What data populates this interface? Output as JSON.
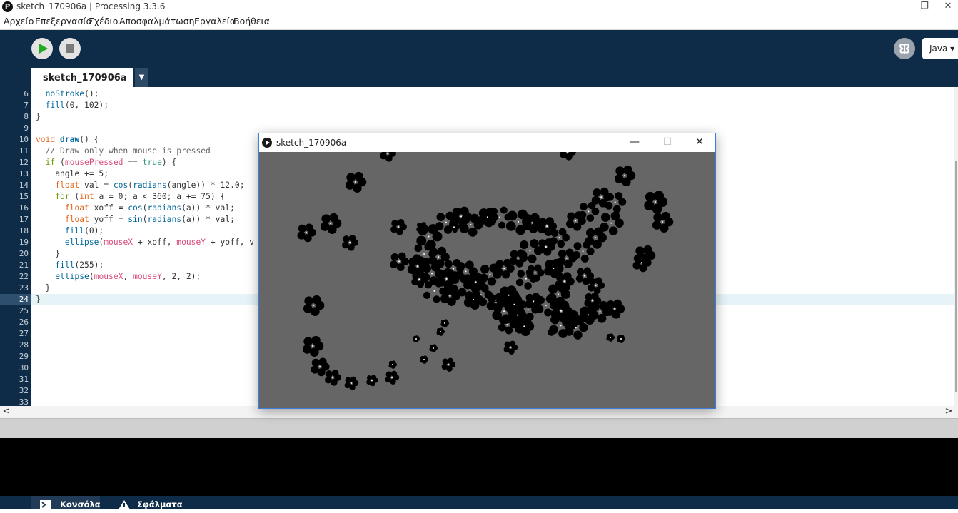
{
  "window": {
    "app_icon_letter": "P",
    "title": "sketch_170906a | Processing 3.3.6",
    "minimize_glyph": "—",
    "restore_glyph": "❐",
    "close_glyph": "✕"
  },
  "menu": [
    "Αρχείο",
    "Επεξεργασία",
    "Σχέδιο",
    "Αποσφαλμάτωση",
    "Εργαλεία",
    "Βοήθεια"
  ],
  "toolbar": {
    "run_icon": "play-icon",
    "stop_icon": "stop-icon",
    "debug_icon": "debugger-butterfly-icon",
    "mode_label": "Java ▾"
  },
  "tab": {
    "label": "sketch_170906a",
    "menu_glyph": "▼"
  },
  "editor": {
    "line_numbers": [
      "6",
      "7",
      "8",
      "9",
      "10",
      "11",
      "12",
      "13",
      "14",
      "15",
      "16",
      "17",
      "18",
      "19",
      "20",
      "21",
      "22",
      "23",
      "24",
      "25",
      "26",
      "27",
      "28",
      "29",
      "30",
      "31",
      "32",
      "33"
    ],
    "current_line": "24",
    "code_lines": [
      "  noStroke();",
      "  fill(0, 102);",
      "}",
      "",
      "void draw() {",
      "  // Draw only when mouse is pressed",
      "  if (mousePressed == true) {",
      "    angle += 5;",
      "    float val = cos(radians(angle)) * 12.0;",
      "    for (int a = 0; a < 360; a += 75) {",
      "      float xoff = cos(radians(a)) * val;",
      "      float yoff = sin(radians(a)) * val;",
      "      fill(0);",
      "      ellipse(mouseX + xoff, mouseY + yoff, v",
      "    }",
      "    fill(255);",
      "    ellipse(mouseX, mouseY, 2, 2);",
      "  }",
      "}"
    ]
  },
  "scroll": {
    "left_arrow": "<",
    "right_arrow": ">"
  },
  "footer": {
    "console_tab": "Κονσόλα",
    "errors_tab": "Σφάλματα"
  },
  "sketch_window": {
    "title": "sketch_170906a",
    "minimize_glyph": "—",
    "maximize_glyph": "☐",
    "close_glyph": "✕"
  },
  "colors": {
    "header_bg": "#0e2b48",
    "canvas_bg": "#666666",
    "run_green": "#22aa22"
  }
}
